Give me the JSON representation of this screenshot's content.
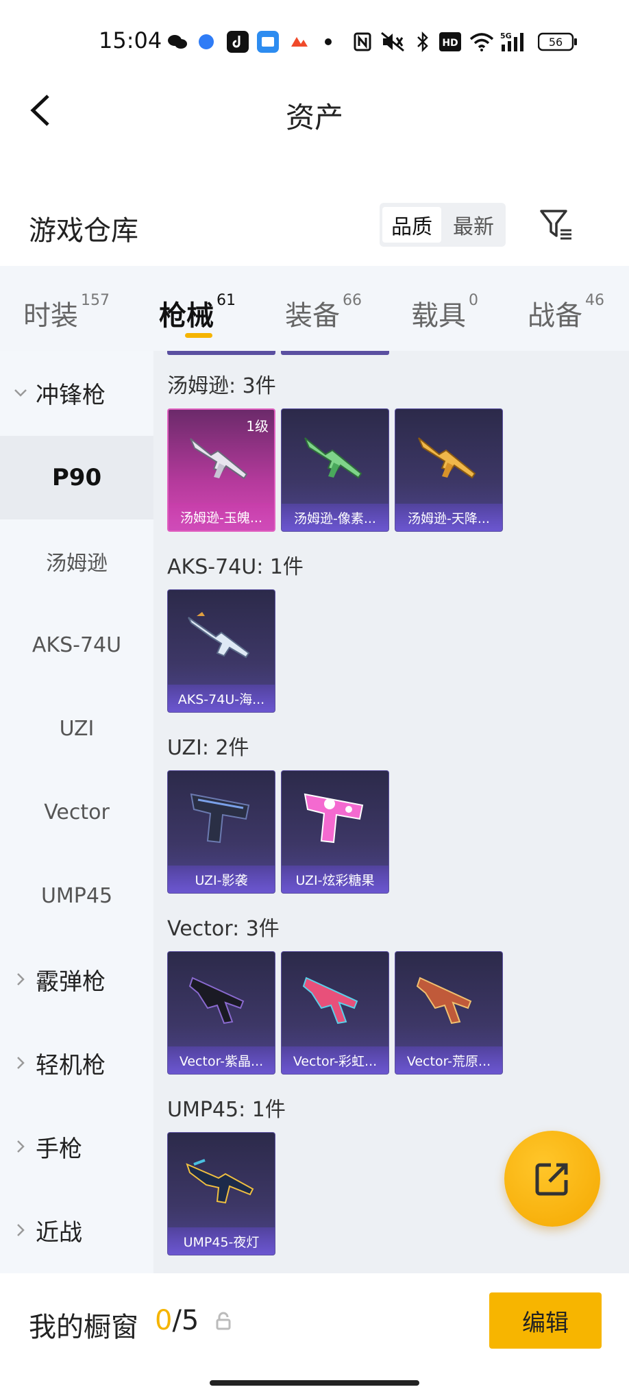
{
  "status": {
    "time": "15:04",
    "battery": "56",
    "network": "5G"
  },
  "header": {
    "title": "资产"
  },
  "warehouse": {
    "title": "游戏仓库"
  },
  "sort": {
    "active": "品质",
    "inactive": "最新"
  },
  "tabs": [
    {
      "label": "时装",
      "count": "157"
    },
    {
      "label": "枪械",
      "count": "61"
    },
    {
      "label": "装备",
      "count": "66"
    },
    {
      "label": "载具",
      "count": "0"
    },
    {
      "label": "战备",
      "count": "46"
    }
  ],
  "sidebar": {
    "cat_smg": "冲锋枪",
    "sub": [
      "P90",
      "汤姆逊",
      "AKS-74U",
      "UZI",
      "Vector",
      "UMP45"
    ],
    "cat_shotgun": "霰弹枪",
    "cat_lmg": "轻机枪",
    "cat_pistol": "手枪",
    "cat_melee": "近战"
  },
  "groups": [
    {
      "title": "汤姆逊: 3件",
      "items": [
        {
          "label": "汤姆逊-玉魄...",
          "level": "1级"
        },
        {
          "label": "汤姆逊-像素..."
        },
        {
          "label": "汤姆逊-天降..."
        }
      ]
    },
    {
      "title": "AKS-74U: 1件",
      "items": [
        {
          "label": "AKS-74U-海..."
        }
      ]
    },
    {
      "title": "UZI: 2件",
      "items": [
        {
          "label": "UZI-影袭"
        },
        {
          "label": "UZI-炫彩糖果"
        }
      ]
    },
    {
      "title": "Vector: 3件",
      "items": [
        {
          "label": "Vector-紫晶..."
        },
        {
          "label": "Vector-彩虹..."
        },
        {
          "label": "Vector-荒原..."
        }
      ]
    },
    {
      "title": "UMP45: 1件",
      "items": [
        {
          "label": "UMP45-夜灯"
        }
      ]
    }
  ],
  "showcase": {
    "title": "我的橱窗",
    "current": "0",
    "total": "/5",
    "edit_label": "编辑"
  },
  "colors": {
    "accent": "#f5b400",
    "card_bg": "#3d3766",
    "card_label": "#6b56d0",
    "sidebar_bg": "#f4f7fb"
  }
}
